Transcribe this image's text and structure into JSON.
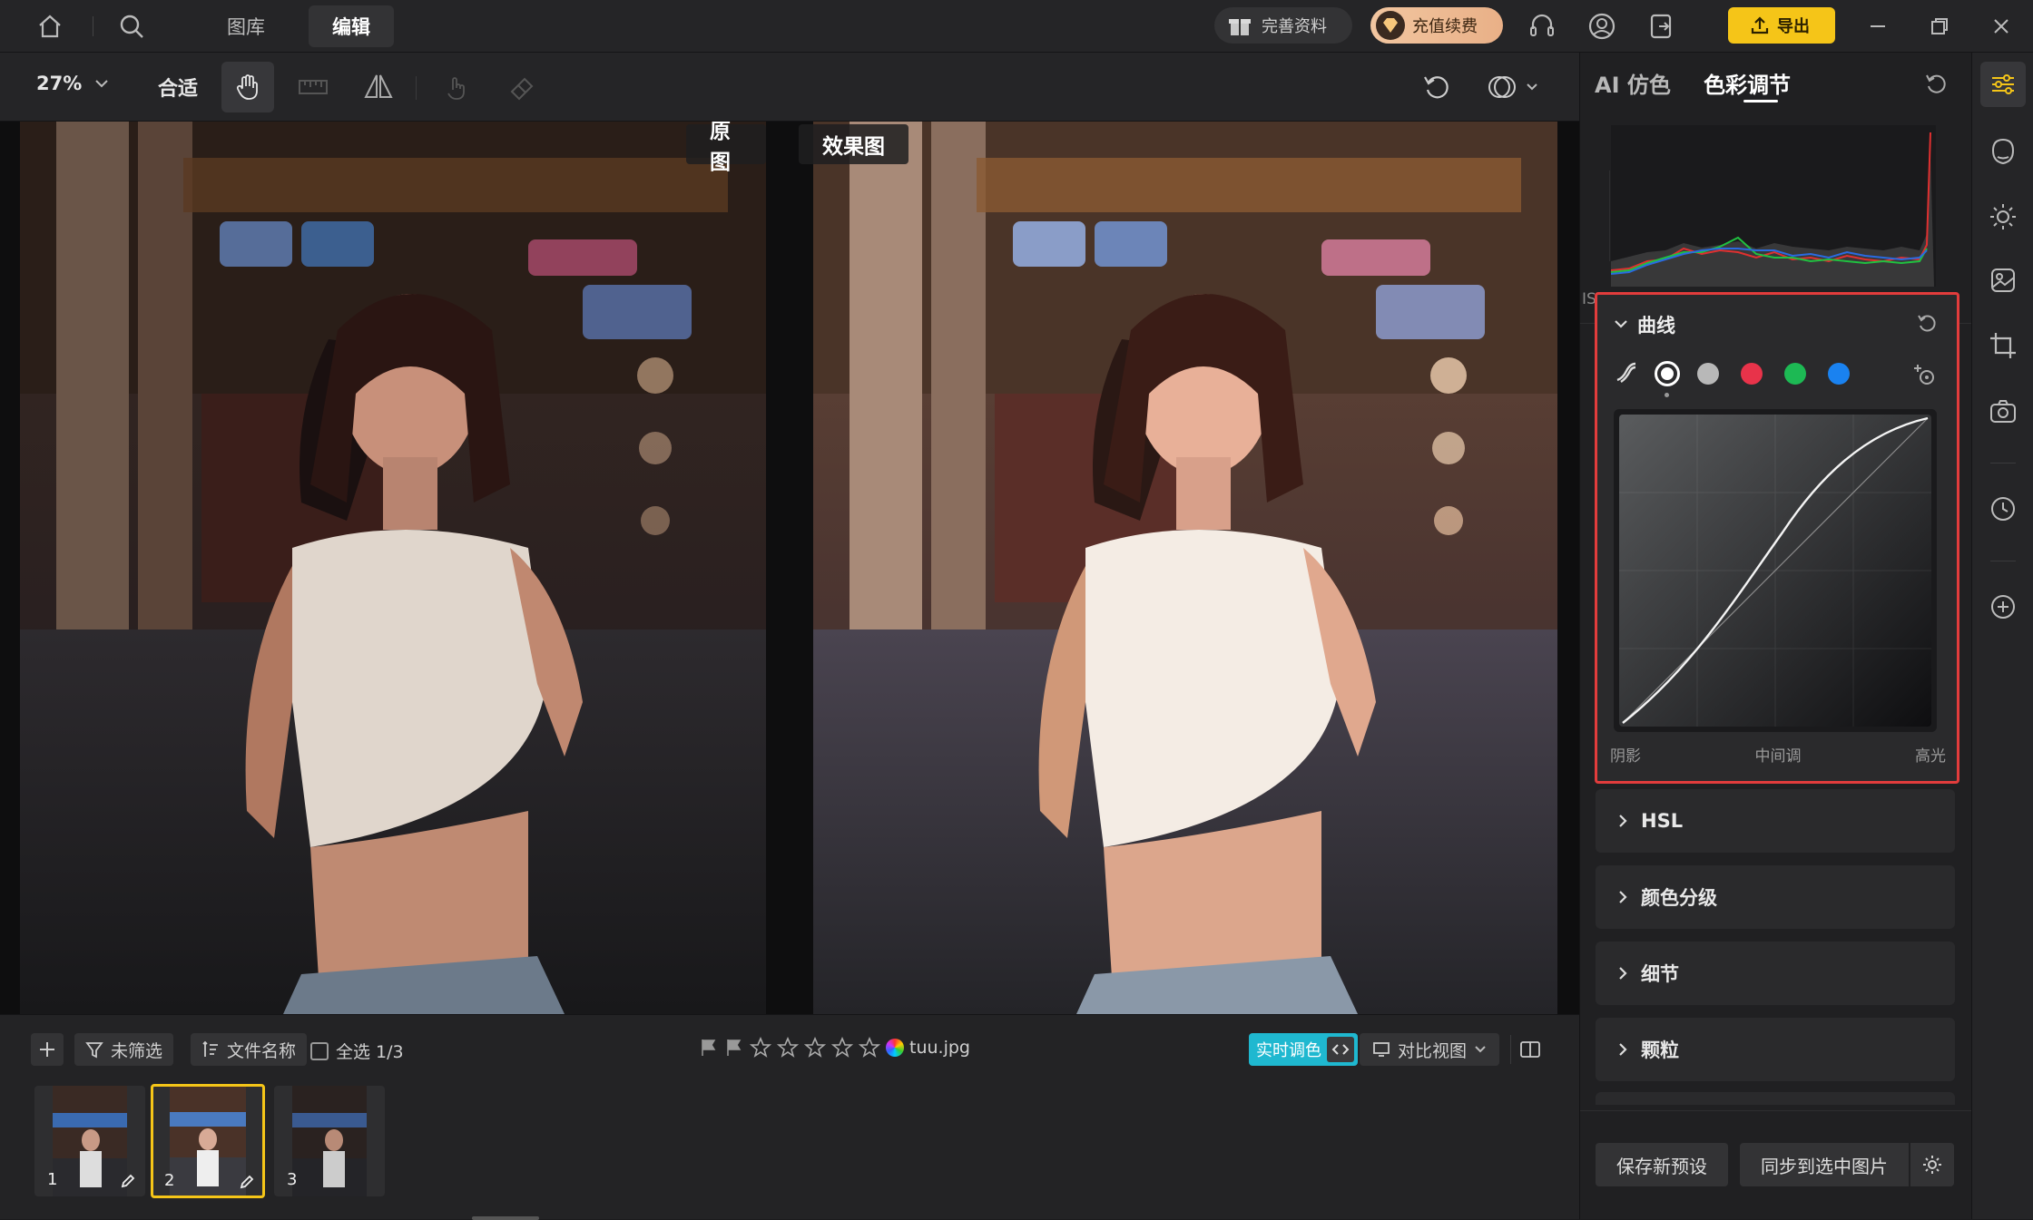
{
  "topbar": {
    "tabs": [
      {
        "label": "图库"
      },
      {
        "label": "编辑"
      }
    ],
    "active_tab": "编辑",
    "profile_label": "完善资料",
    "recharge_label": "充值续费",
    "export_label": "导出",
    "accent_color": "#f5c518"
  },
  "toolbar": {
    "zoom": "27%",
    "fit_label": "合适"
  },
  "canvas": {
    "original_label": "原图",
    "effect_label": "效果图"
  },
  "filmbar": {
    "filter_label": "未筛选",
    "sort_label": "文件名称",
    "select_all_label": "全选 1/3",
    "filename": "tuu.jpg",
    "realtime_label": "实时调色",
    "compare_label": "对比视图",
    "thumbs": [
      {
        "num": "1"
      },
      {
        "num": "2"
      },
      {
        "num": "3"
      }
    ],
    "selected_thumb": 2
  },
  "panel": {
    "tabs": [
      {
        "label": "AI 仿色"
      },
      {
        "label": "色彩调节"
      }
    ],
    "active_tab": "色彩调节",
    "histogram": {
      "iso": "ISO --",
      "mid": "--",
      "right": "--"
    },
    "curve": {
      "title": "曲线",
      "labels": {
        "shadow": "阴影",
        "mid": "中间调",
        "highlight": "高光"
      },
      "channels": [
        {
          "name": "white-rgb",
          "color": "#ffffff"
        },
        {
          "name": "gray",
          "color": "#b8b8b8"
        },
        {
          "name": "red",
          "color": "#e8334a"
        },
        {
          "name": "green",
          "color": "#1db954"
        },
        {
          "name": "blue",
          "color": "#1a82f0"
        }
      ],
      "highlight_color": "#e23c3c"
    },
    "sections": [
      {
        "label": "HSL"
      },
      {
        "label": "颜色分级"
      },
      {
        "label": "细节"
      },
      {
        "label": "颗粒"
      }
    ],
    "save_preset_label": "保存新预设",
    "sync_label": "同步到选中图片"
  }
}
